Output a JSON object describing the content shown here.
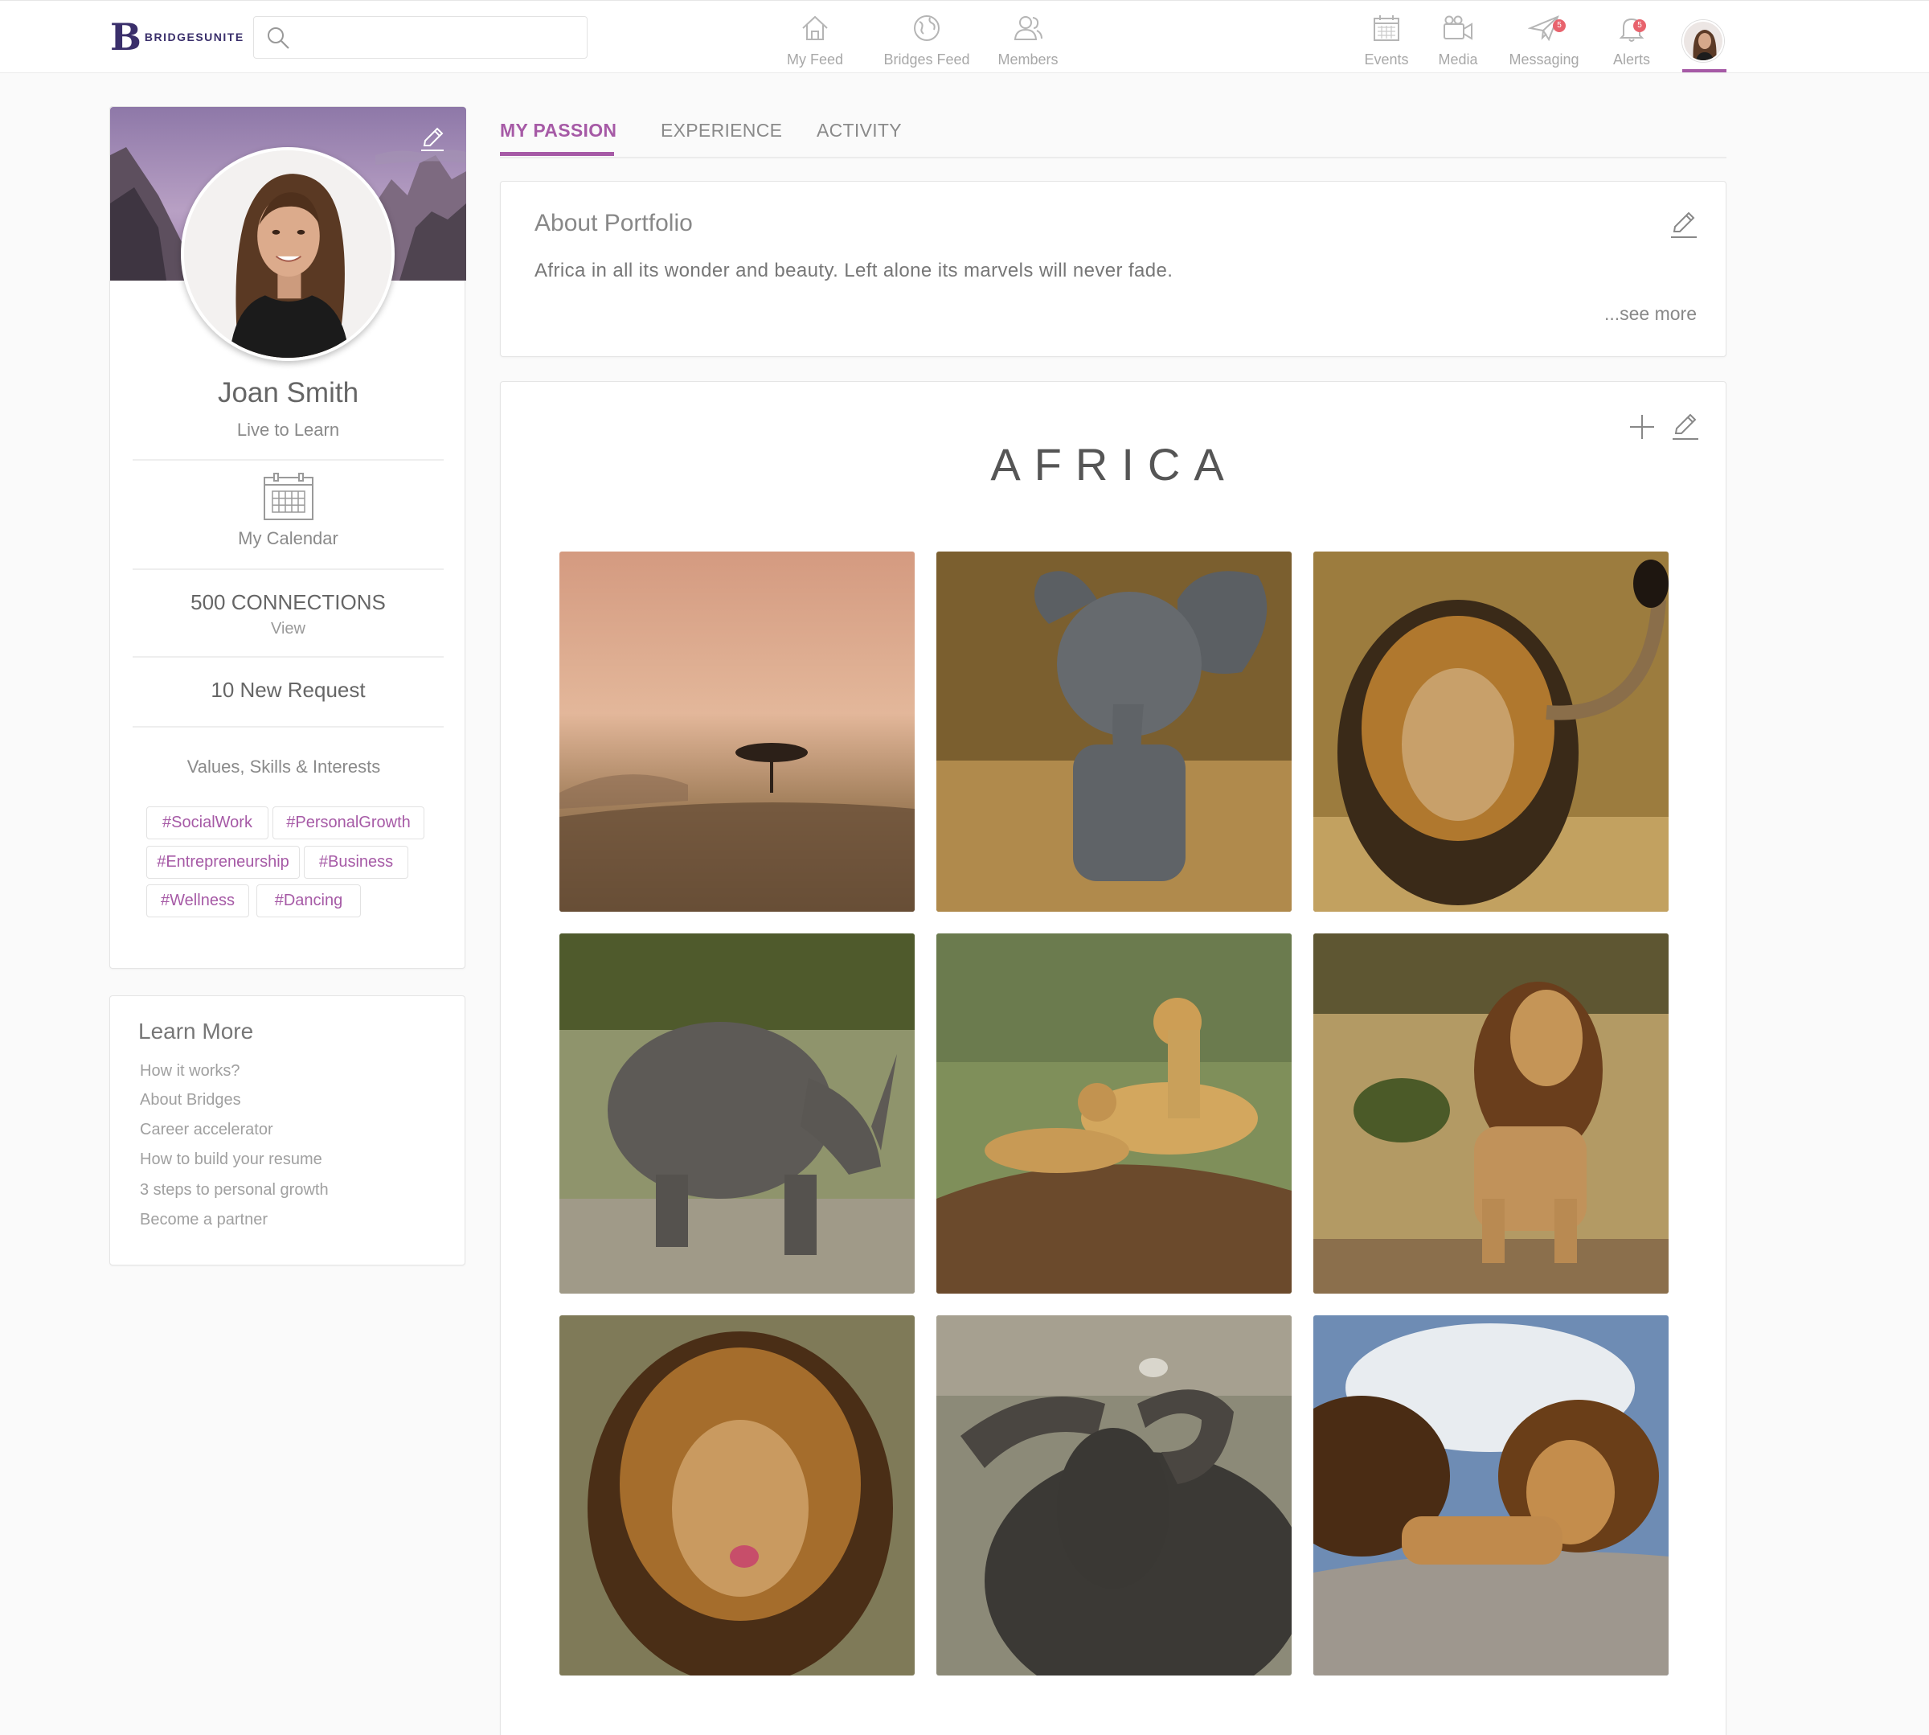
{
  "brand": {
    "name": "BRIDGESUNITE",
    "letter": "B"
  },
  "search": {
    "placeholder": ""
  },
  "nav_center": [
    {
      "label": "My Feed",
      "icon": "home-icon"
    },
    {
      "label": "Bridges Feed",
      "icon": "globe-icon"
    },
    {
      "label": "Members",
      "icon": "members-icon"
    }
  ],
  "nav_right": [
    {
      "label": "Events",
      "icon": "calendar-icon"
    },
    {
      "label": "Media",
      "icon": "video-camera-icon"
    },
    {
      "label": "Messaging",
      "icon": "paper-plane-icon",
      "badge": "5"
    },
    {
      "label": "Alerts",
      "icon": "bell-icon",
      "badge": "5"
    }
  ],
  "profile": {
    "name": "Joan Smith",
    "tagline": "Live to Learn",
    "calendar_label": "My Calendar",
    "connections": "500 CONNECTIONS",
    "connections_view": "View",
    "requests": "10 New Request",
    "values_title": "Values, Skills & Interests",
    "tags": [
      "#SocialWork",
      "#PersonalGrowth",
      "#Entrepreneurship",
      "#Business",
      "#Wellness",
      "#Dancing"
    ]
  },
  "learn_more": {
    "title": "Learn More",
    "links": [
      "How it works?",
      "About Bridges",
      "Career accelerator",
      "How to build your resume",
      "3 steps to personal growth",
      "Become a partner"
    ]
  },
  "tabs": [
    {
      "label": "MY PASSION",
      "active": true
    },
    {
      "label": "EXPERIENCE",
      "active": false
    },
    {
      "label": "ACTIVITY",
      "active": false
    }
  ],
  "about": {
    "title": "About Portfolio",
    "text": "Africa in all its wonder and beauty. Left alone its marvels will never fade.",
    "see_more": "...see more"
  },
  "gallery": {
    "title": "AFRICA",
    "photos": [
      "acacia tree in misty savanna",
      "baby elephant in grass",
      "lion with tail raised",
      "rhinoceros walking on path",
      "cheetahs resting on mound",
      "lion standing in savanna",
      "lion licking lips",
      "cape buffalo with bird",
      "two lions on rock"
    ]
  },
  "colors": {
    "accent": "#a65aa6",
    "brand": "#3a2f6b",
    "badge": "#e8636d"
  }
}
